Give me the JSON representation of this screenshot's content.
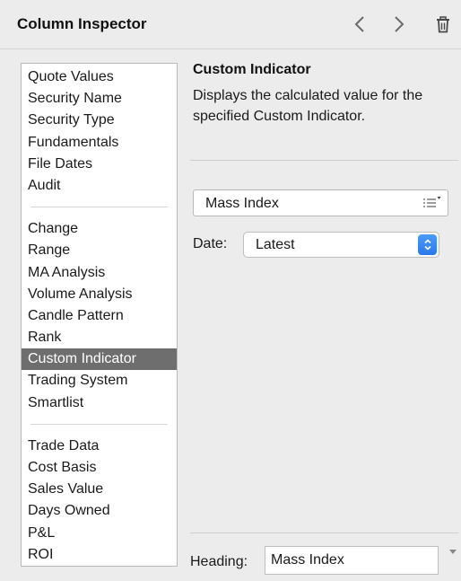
{
  "header": {
    "title": "Column Inspector",
    "back_icon": "chevron-left-icon",
    "forward_icon": "chevron-right-icon",
    "delete_icon": "trash-icon"
  },
  "sidebar": {
    "groups": [
      [
        "Quote Values",
        "Security Name",
        "Security Type",
        "Fundamentals",
        "File Dates",
        "Audit"
      ],
      [
        "Change",
        "Range",
        "MA Analysis",
        "Volume Analysis",
        "Candle Pattern",
        "Rank",
        "Custom Indicator",
        "Trading System",
        "Smartlist"
      ],
      [
        "Trade Data",
        "Cost Basis",
        "Sales Value",
        "Days Owned",
        "P&L",
        "ROI"
      ]
    ],
    "selected": "Custom Indicator"
  },
  "detail": {
    "title": "Custom Indicator",
    "description": "Displays the calculated value for the specified Custom Indicator.",
    "indicator_value": "Mass Index",
    "date_label": "Date:",
    "date_value": "Latest",
    "heading_label": "Heading:",
    "heading_value": "Mass Index"
  },
  "colors": {
    "selected_bg": "#6e6e6e",
    "accent": "#2a78ee"
  }
}
